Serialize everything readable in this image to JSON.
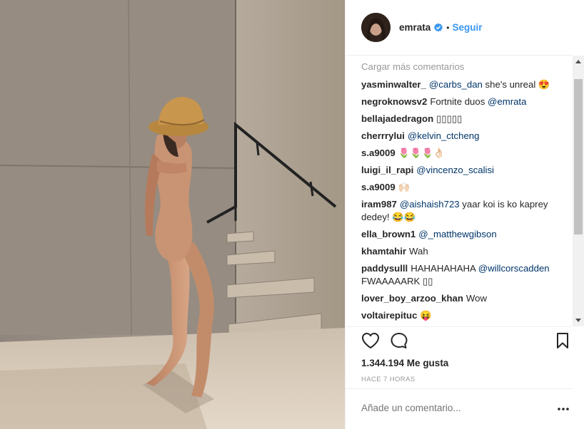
{
  "post": {
    "username": "emrata",
    "verified_icon": "verified-badge-icon",
    "separator": "•",
    "follow_label": "Seguir"
  },
  "comments": {
    "load_more": "Cargar más comentarios",
    "items": [
      {
        "user": "yasminwalter_",
        "mention": "@carbs_dan",
        "text": " she's unreal 😍"
      },
      {
        "user": "negroknowsv2",
        "text": "Fortnite duos ",
        "mention_after": "@emrata"
      },
      {
        "user": "bellajadedragon",
        "text": "▯▯▯▯▯"
      },
      {
        "user": "cherrrylui",
        "mention": "@kelvin_ctcheng",
        "text": ""
      },
      {
        "user": "s.a9009",
        "text": "🌷🌷🌷👌🏻"
      },
      {
        "user": "luigi_il_rapi",
        "mention": "@vincenzo_scalisi",
        "text": ""
      },
      {
        "user": "s.a9009",
        "text": "🙌🏻"
      },
      {
        "user": "iram987",
        "mention": "@aishaish723",
        "text": " yaar koi is ko kaprey dedey! 😂😂"
      },
      {
        "user": "ella_brown1",
        "mention": "@_matthewgibson",
        "text": ""
      },
      {
        "user": "khamtahir",
        "text": "Wah"
      },
      {
        "user": "paddysulll",
        "text": "HAHAHAHAHA ",
        "mention_after": "@willcorscadden",
        "text_after": " FWAAAAARK ▯▯"
      },
      {
        "user": "lover_boy_arzoo_khan",
        "text": "Wow"
      },
      {
        "user": "voltairepituc",
        "text": "😝"
      }
    ]
  },
  "actions": {
    "like_icon": "heart-icon",
    "comment_icon": "comment-bubble-icon",
    "save_icon": "bookmark-icon"
  },
  "likes_text": "1.344.194 Me gusta",
  "time_text": "HACE 7 HORAS",
  "add_comment_placeholder": "Añade un comentario...",
  "more_icon": "more-options-icon"
}
